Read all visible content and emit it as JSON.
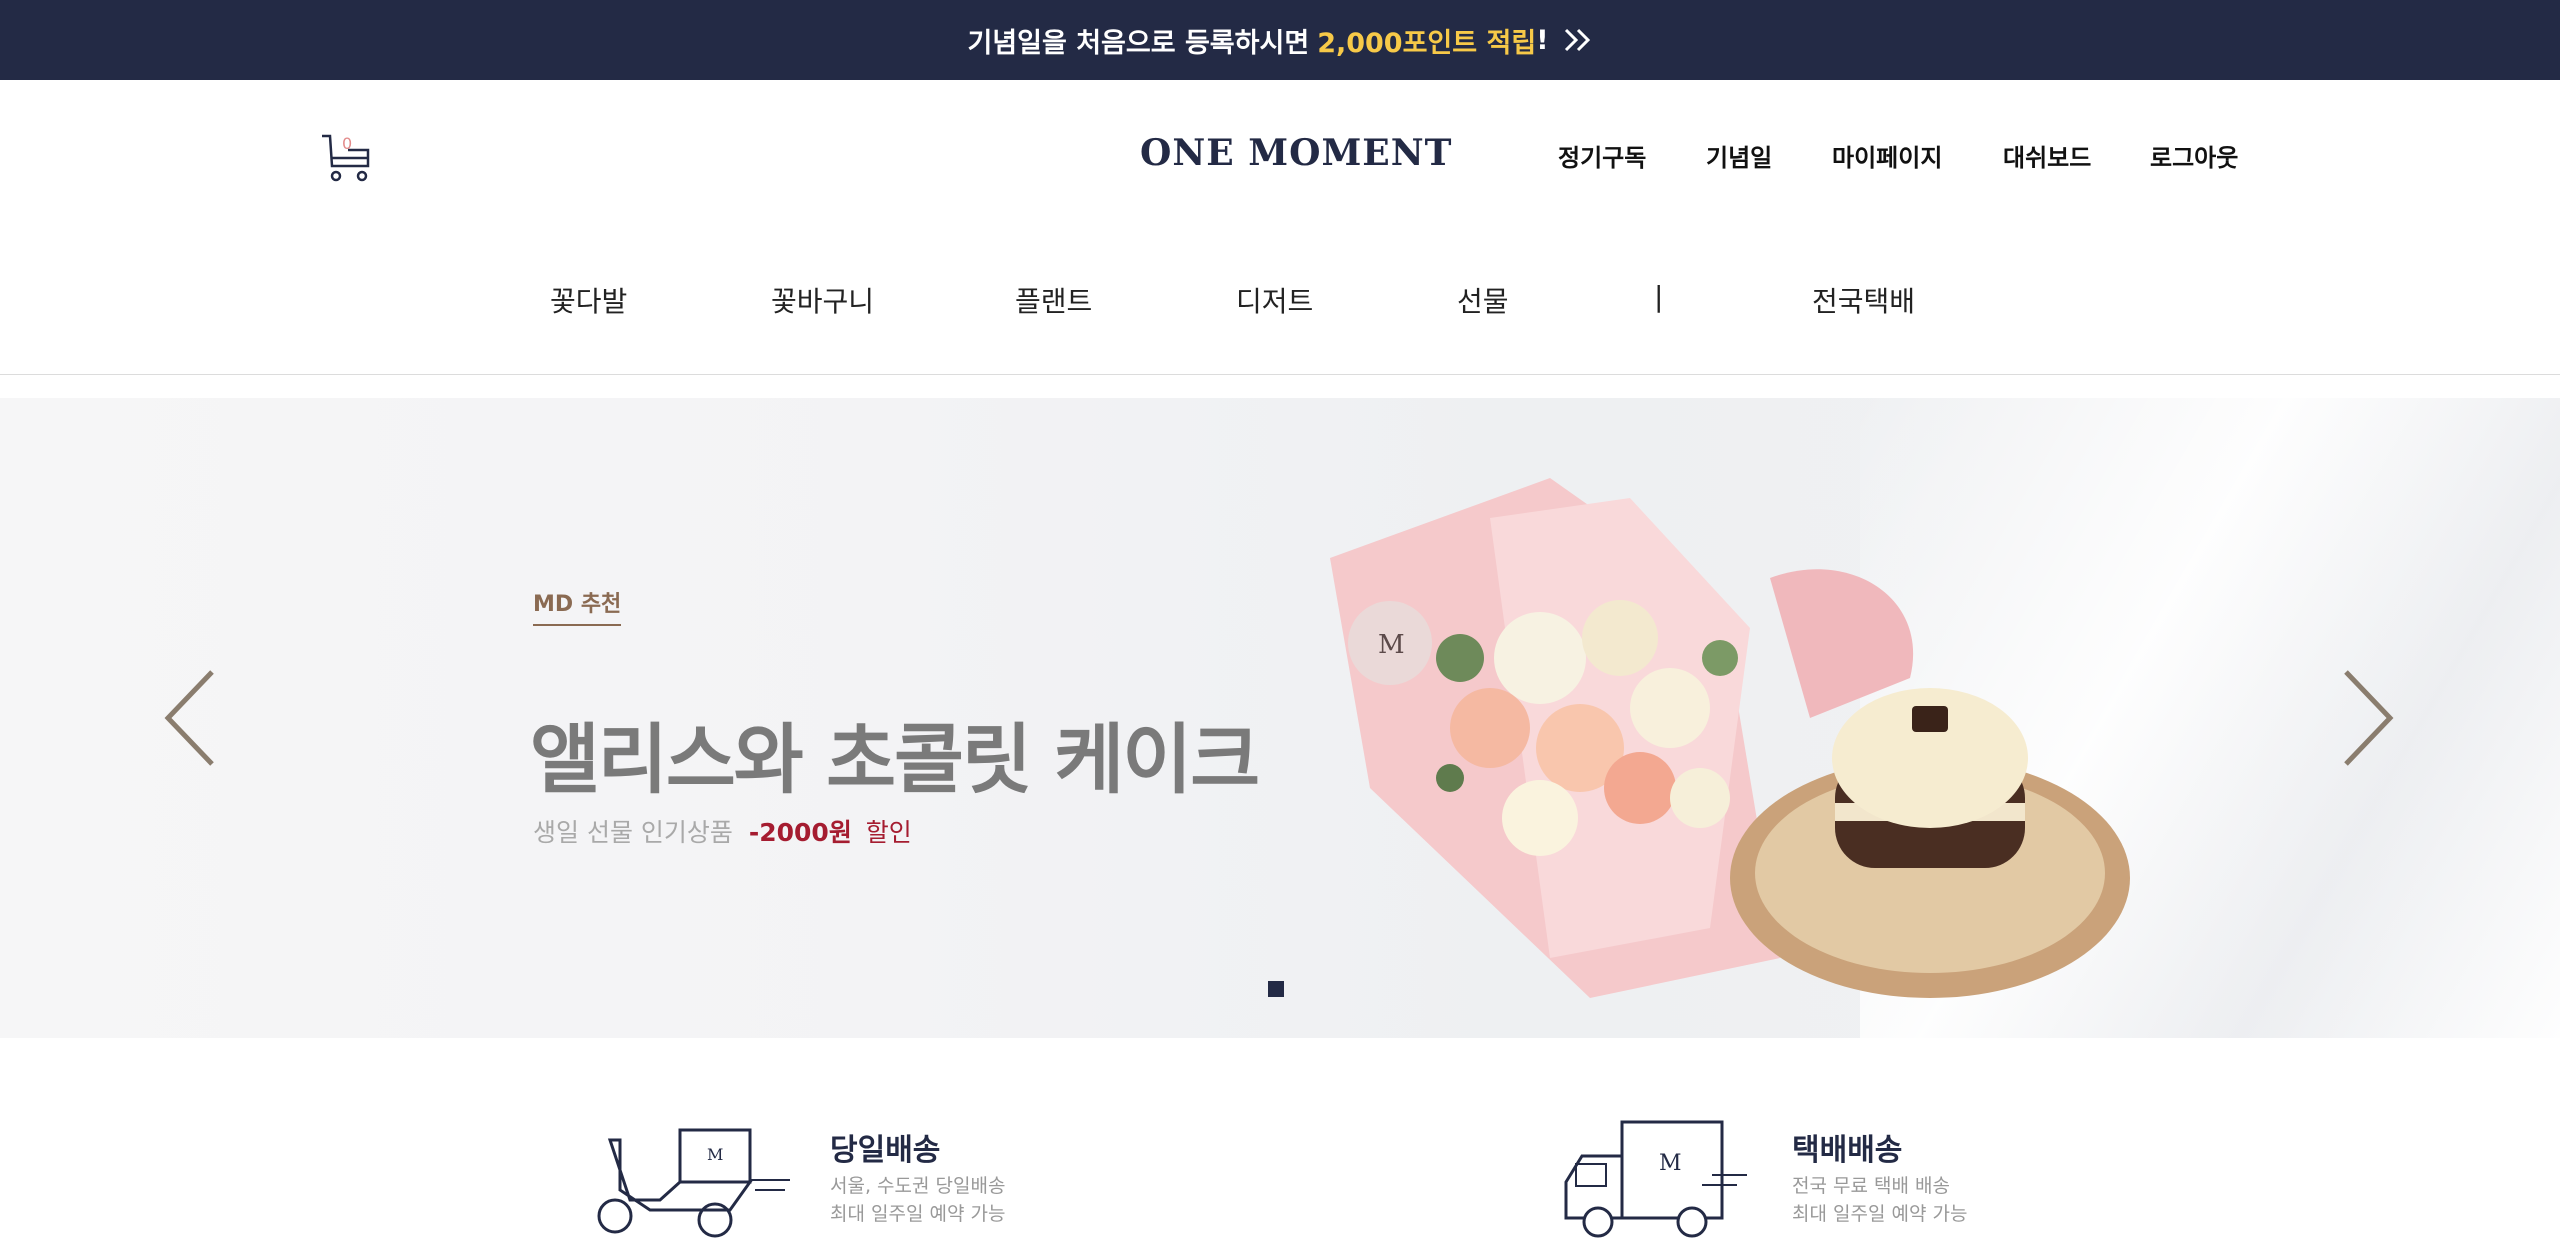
{
  "promo": {
    "text": "기념일을 처음으로 등록하시면",
    "highlight": "2,000포인트 적립",
    "suffix": "!"
  },
  "header": {
    "cart_count": "0",
    "logo": "ONE MOMENT",
    "util_links": [
      "정기구독",
      "기념일",
      "마이페이지",
      "대쉬보드",
      "로그아웃"
    ]
  },
  "nav": {
    "items": [
      "꽃다발",
      "꽃바구니",
      "플랜트",
      "디저트",
      "선물",
      "|",
      "전국택배"
    ]
  },
  "hero": {
    "badge": "MD 추천",
    "headline": "앨리스와 초콜릿 케이크",
    "sub": "생일 선물 인기상품",
    "discount": "-2000원",
    "discount_word": "할인",
    "pagination_total": 1,
    "pagination_active": 1
  },
  "features": [
    {
      "icon": "scooter-icon",
      "title": "당일배송",
      "desc1": "서울, 수도권 당일배송",
      "desc2": "최대 일주일 예약 가능"
    },
    {
      "icon": "truck-icon",
      "title": "택배배송",
      "desc1": "전국 무료 택배 배송",
      "desc2": "최대 일주일 예약 가능"
    }
  ],
  "colors": {
    "navy": "#232a45",
    "promo_highlight": "#f7c948",
    "discount_red": "#a51c30",
    "badge_brown": "#8a6a52"
  }
}
